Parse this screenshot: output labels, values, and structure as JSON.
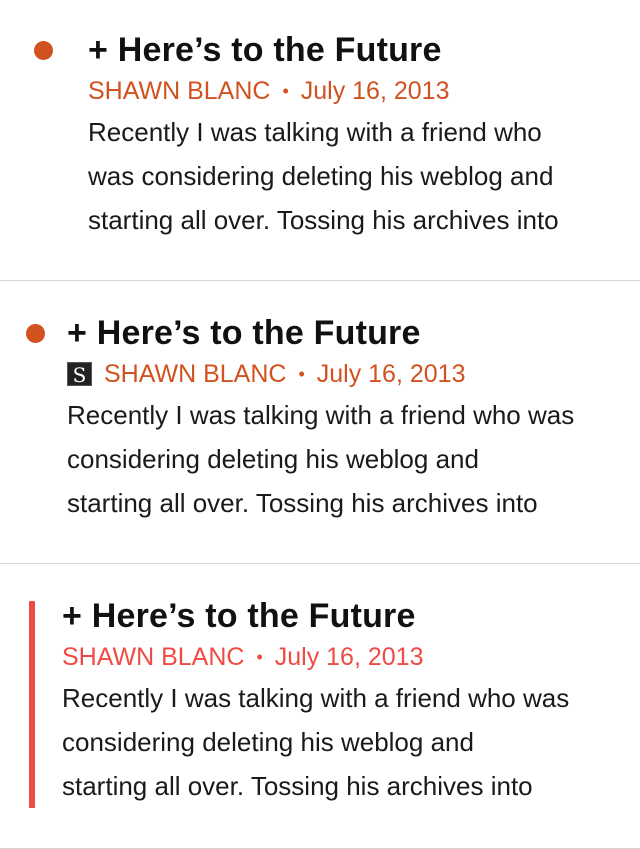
{
  "items": [
    {
      "title": "+ Here’s to the Future",
      "author": "SHAWN BLANC",
      "separator": "•",
      "date": "July 16, 2013",
      "excerpt_lines": [
        "Recently I was talking with a friend who",
        "was considering deleting his weblog and",
        "starting all over. Tossing his archives into"
      ],
      "accent_color": "#d2521f",
      "marker": "unread-dot"
    },
    {
      "title": "+ Here’s to the Future",
      "favicon_letter": "S",
      "author": "SHAWN BLANC",
      "separator": "•",
      "date": "July 16, 2013",
      "excerpt_lines": [
        "Recently I was talking with a friend who was",
        "considering deleting his weblog and",
        "starting all over. Tossing his archives into"
      ],
      "accent_color": "#d2521f",
      "marker": "unread-dot"
    },
    {
      "title": "+ Here’s to the Future",
      "author": "SHAWN BLANC",
      "separator": "•",
      "date": "July 16, 2013",
      "excerpt_lines": [
        "Recently I was talking with a friend who was",
        "considering deleting his weblog and",
        "starting all over. Tossing his archives into"
      ],
      "accent_color": "#ef4b45",
      "marker": "selected-bar"
    }
  ]
}
